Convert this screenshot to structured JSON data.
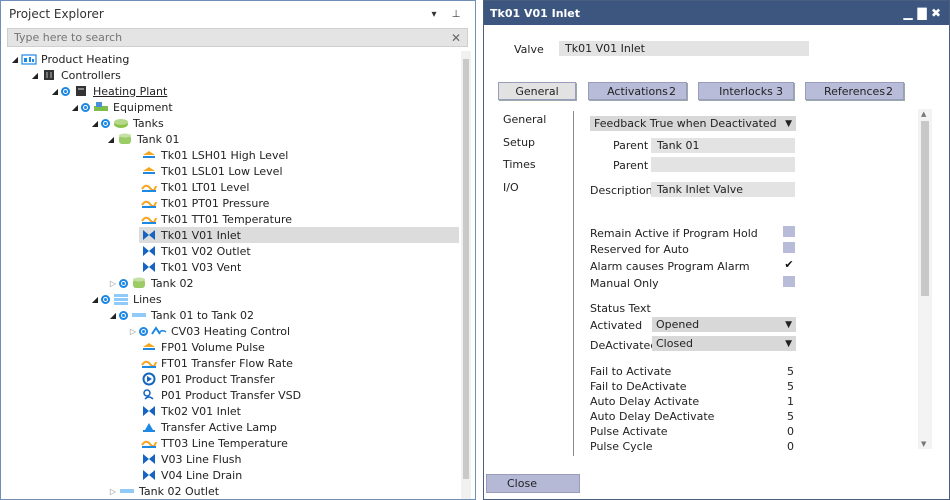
{
  "explorer": {
    "title": "Project Explorer",
    "pin_glyph": "▾",
    "dock_glyph": "⊥",
    "search_placeholder": "Type here to search",
    "clear_glyph": "✕",
    "nodes": [
      {
        "label": "Product Heating",
        "icon": "project-icon"
      },
      {
        "label": "Controllers",
        "icon": "controller-icon"
      },
      {
        "label": "Heating Plant",
        "icon": "plant-icon"
      },
      {
        "label": "Equipment",
        "icon": "equipment-icon"
      },
      {
        "label": "Tanks",
        "icon": "tanks-icon"
      },
      {
        "label": "Tank 01",
        "icon": "tank-icon"
      },
      {
        "label": "Tk01 LSH01 High Level",
        "icon": "level-switch-icon"
      },
      {
        "label": "Tk01 LSL01 Low Level",
        "icon": "level-switch-icon"
      },
      {
        "label": "Tk01 LT01 Level",
        "icon": "transmitter-icon"
      },
      {
        "label": "Tk01 PT01 Pressure",
        "icon": "transmitter-icon"
      },
      {
        "label": "Tk01 TT01 Temperature",
        "icon": "transmitter-icon"
      },
      {
        "label": "Tk01 V01 Inlet",
        "icon": "valve-icon"
      },
      {
        "label": "Tk01 V02 Outlet",
        "icon": "valve-icon"
      },
      {
        "label": "Tk01 V03 Vent",
        "icon": "valve-icon"
      },
      {
        "label": "Tank 02",
        "icon": "tank-icon"
      },
      {
        "label": "Lines",
        "icon": "lines-icon"
      },
      {
        "label": "Tank 01 to Tank 02",
        "icon": "line-icon"
      },
      {
        "label": "CV03 Heating Control",
        "icon": "control-loop-icon"
      },
      {
        "label": "FP01 Volume Pulse",
        "icon": "pulse-icon"
      },
      {
        "label": "FT01 Transfer Flow Rate",
        "icon": "transmitter-icon"
      },
      {
        "label": "P01 Product Transfer",
        "icon": "pump-icon"
      },
      {
        "label": "P01 Product Transfer VSD",
        "icon": "vsd-icon"
      },
      {
        "label": "Tk02 V01 Inlet",
        "icon": "valve-icon"
      },
      {
        "label": "Transfer Active Lamp",
        "icon": "lamp-icon"
      },
      {
        "label": "TT03 Line Temperature",
        "icon": "transmitter-icon"
      },
      {
        "label": "V03 Line Flush",
        "icon": "valve-icon"
      },
      {
        "label": "V04 Line Drain",
        "icon": "valve-icon"
      },
      {
        "label": "Tank 02 Outlet",
        "icon": "line-icon"
      }
    ]
  },
  "detail": {
    "title": "Tk01 V01 Inlet",
    "min_glyph": "▁",
    "max_glyph": "▇",
    "close_glyph": "✖",
    "valve_label": "Valve",
    "valve_value": "Tk01 V01 Inlet",
    "tabs": [
      {
        "label": "General",
        "count": ""
      },
      {
        "label": "Activations",
        "count": "2"
      },
      {
        "label": "Interlocks",
        "count": "3"
      },
      {
        "label": "References",
        "count": "2"
      }
    ],
    "side_nav": [
      "General",
      "Setup",
      "Times",
      "I/O"
    ],
    "feedback_option": "Feedback True when Deactivated",
    "parent_label": "Parent",
    "parent1_value": "Tank 01",
    "parent2_value": "",
    "description_label": "Description",
    "description_value": "Tank Inlet Valve",
    "checks": [
      {
        "label": "Remain Active if Program Hold",
        "checked": false
      },
      {
        "label": "Reserved for Auto",
        "checked": false
      },
      {
        "label": "Alarm causes Program Alarm",
        "checked": true
      },
      {
        "label": "Manual Only",
        "checked": false
      }
    ],
    "check_glyph": "✔",
    "status_text_label": "Status Text",
    "activated_label": "Activated",
    "activated_value": "Opened",
    "deactivated_label": "DeActivated",
    "deactivated_value": "Closed",
    "dropdown_glyph": "▼",
    "times": [
      {
        "label": "Fail to Activate",
        "value": "5"
      },
      {
        "label": "Fail to DeActivate",
        "value": "5"
      },
      {
        "label": "Auto Delay Activate",
        "value": "1"
      },
      {
        "label": "Auto Delay DeActivate",
        "value": "5"
      },
      {
        "label": "Pulse Activate",
        "value": "0"
      },
      {
        "label": "Pulse Cycle",
        "value": "0"
      }
    ],
    "close_button": "Close"
  },
  "colors": {
    "title_bar": "#3c5680",
    "tab_fill": "#b9bcd8",
    "tree_dot": "#1e88e5",
    "valve_blue": "#1565c0",
    "sensor_orange": "#f5a623"
  }
}
